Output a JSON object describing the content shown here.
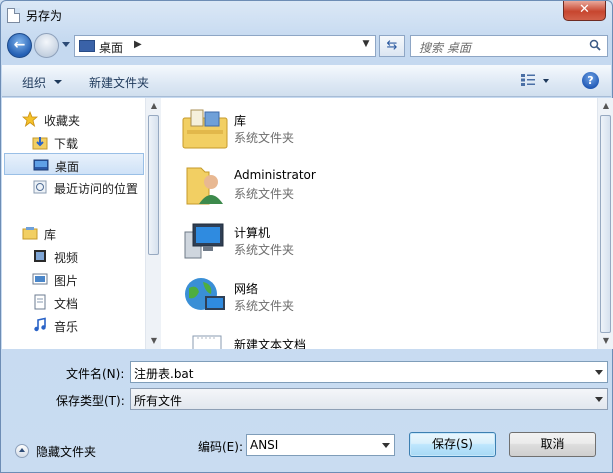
{
  "window": {
    "title": "另存为",
    "close_label": "✕"
  },
  "navigation": {
    "address_location": "桌面",
    "search_placeholder": "搜索 桌面"
  },
  "toolbar": {
    "organize_label": "组织",
    "new_folder_label": "新建文件夹",
    "help_label": "?"
  },
  "nav_pane": {
    "favorites": [
      {
        "label": "收藏夹",
        "icon": "star-icon"
      },
      {
        "label": "下载",
        "icon": "download-folder-icon"
      },
      {
        "label": "桌面",
        "icon": "desktop-icon",
        "selected": true
      },
      {
        "label": "最近访问的位置",
        "icon": "recent-places-icon"
      }
    ],
    "libraries": [
      {
        "label": "库",
        "icon": "library-icon"
      },
      {
        "label": "视频",
        "icon": "video-icon"
      },
      {
        "label": "图片",
        "icon": "picture-icon"
      },
      {
        "label": "文档",
        "icon": "document-icon"
      },
      {
        "label": "音乐",
        "icon": "music-icon"
      }
    ]
  },
  "files": [
    {
      "name": "库",
      "type": "系统文件夹",
      "icon": "library-icon"
    },
    {
      "name": "Administrator",
      "type": "系统文件夹",
      "icon": "user-folder-icon"
    },
    {
      "name": "计算机",
      "type": "系统文件夹",
      "icon": "computer-icon"
    },
    {
      "name": "网络",
      "type": "系统文件夹",
      "icon": "network-icon"
    },
    {
      "name": "新建文本文档",
      "type": "",
      "icon": "text-document-icon"
    }
  ],
  "form": {
    "filename_label": "文件名(N):",
    "filename_value": "注册表.bat",
    "filetype_label": "保存类型(T):",
    "filetype_value": "所有文件",
    "encoding_label": "编码(E):",
    "encoding_value": "ANSI"
  },
  "footer": {
    "hide_folders_label": "隐藏文件夹",
    "save_label": "保存(S)",
    "cancel_label": "取消"
  }
}
